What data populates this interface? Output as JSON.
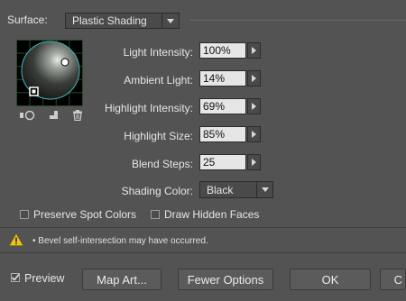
{
  "surface": {
    "label": "Surface:",
    "value": "Plastic Shading"
  },
  "sphere_tools": [
    "new-light-icon",
    "send-light-to-back-icon",
    "delete-light-icon"
  ],
  "params": {
    "light_intensity": {
      "label": "Light Intensity:",
      "value": "100%"
    },
    "ambient_light": {
      "label": "Ambient Light:",
      "value": "14%"
    },
    "highlight_intensity": {
      "label": "Highlight Intensity:",
      "value": "69%"
    },
    "highlight_size": {
      "label": "Highlight Size:",
      "value": "85%"
    },
    "blend_steps": {
      "label": "Blend Steps:",
      "value": "25"
    }
  },
  "shading_color": {
    "label": "Shading Color:",
    "value": "Black"
  },
  "options": {
    "preserve_spot_colors": {
      "label": "Preserve Spot Colors",
      "checked": false
    },
    "draw_hidden_faces": {
      "label": "Draw Hidden Faces",
      "checked": false
    }
  },
  "warning": {
    "icon": "warning-icon",
    "text": "• Bevel self-intersection may have occurred."
  },
  "footer": {
    "preview": {
      "label": "Preview",
      "checked": true
    },
    "map_art": "Map Art...",
    "fewer_options": "Fewer Options",
    "ok": "OK",
    "cancel": "C"
  },
  "colors": {
    "panel": "#535353",
    "field": "#e6e6e6",
    "warning": "#f0c419"
  }
}
